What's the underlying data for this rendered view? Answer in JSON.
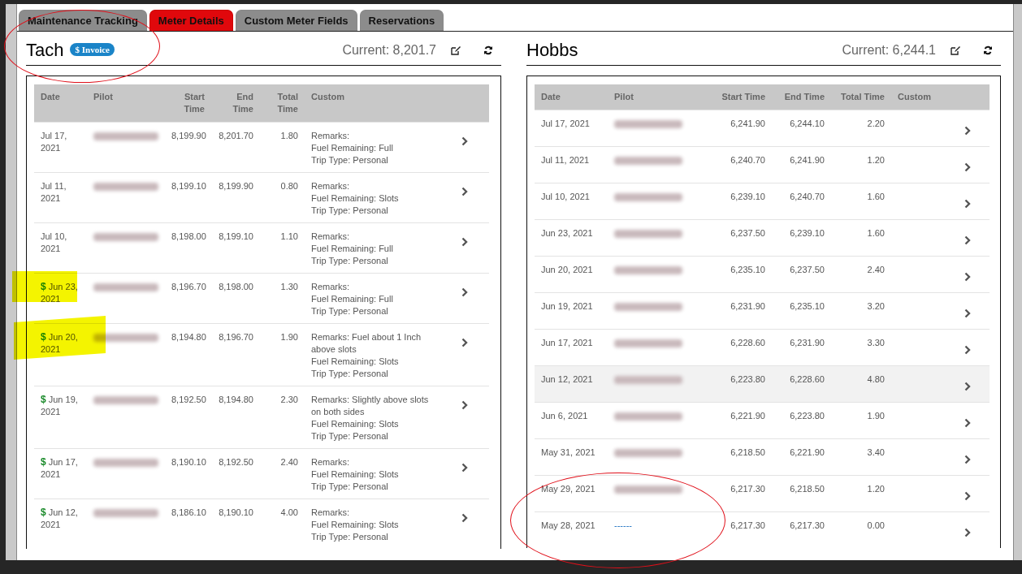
{
  "tabs": [
    {
      "label": "Maintenance Tracking",
      "selected": false
    },
    {
      "label": "Meter Details",
      "selected": true
    },
    {
      "label": "Custom Meter Fields",
      "selected": false
    },
    {
      "label": "Reservations",
      "selected": false
    }
  ],
  "tach": {
    "title": "Tach",
    "badge": "$ Invoice",
    "current": "Current: 8,201.7",
    "columns": [
      "Date",
      "Pilot",
      "Start Time",
      "End Time",
      "Total Time",
      "Custom"
    ],
    "rows": [
      {
        "invoice_mark": "",
        "date": "Jul 17, 2021",
        "pilot_redacted": true,
        "start": "8,199.90",
        "end": "8,201.70",
        "total": "1.80",
        "custom": [
          "Remarks:",
          "Fuel Remaining: Full",
          "Trip Type: Personal"
        ]
      },
      {
        "invoice_mark": "",
        "date": "Jul 11, 2021",
        "pilot_redacted": true,
        "start": "8,199.10",
        "end": "8,199.90",
        "total": "0.80",
        "custom": [
          "Remarks:",
          "Fuel Remaining: Slots",
          "Trip Type: Personal"
        ]
      },
      {
        "invoice_mark": "",
        "date": "Jul 10, 2021",
        "pilot_redacted": true,
        "start": "8,198.00",
        "end": "8,199.10",
        "total": "1.10",
        "custom": [
          "Remarks:",
          "Fuel Remaining: Full",
          "Trip Type: Personal"
        ]
      },
      {
        "invoice_mark": "$",
        "date": "Jun 23, 2021",
        "pilot_redacted": true,
        "start": "8,196.70",
        "end": "8,198.00",
        "total": "1.30",
        "custom": [
          "Remarks:",
          "Fuel Remaining: Full",
          "Trip Type: Personal"
        ]
      },
      {
        "invoice_mark": "$",
        "date": "Jun 20, 2021",
        "pilot_redacted": true,
        "start": "8,194.80",
        "end": "8,196.70",
        "total": "1.90",
        "custom": [
          "Remarks: Fuel about 1 Inch above slots",
          "Fuel Remaining: Slots",
          "Trip Type: Personal"
        ]
      },
      {
        "invoice_mark": "$",
        "date": "Jun 19, 2021",
        "pilot_redacted": true,
        "start": "8,192.50",
        "end": "8,194.80",
        "total": "2.30",
        "custom": [
          "Remarks: Slightly above slots on both sides",
          "Fuel Remaining: Slots",
          "Trip Type: Personal"
        ]
      },
      {
        "invoice_mark": "$",
        "date": "Jun 17, 2021",
        "pilot_redacted": true,
        "start": "8,190.10",
        "end": "8,192.50",
        "total": "2.40",
        "custom": [
          "Remarks:",
          "Fuel Remaining: Slots",
          "Trip Type: Personal"
        ]
      },
      {
        "invoice_mark": "$",
        "date": "Jun 12, 2021",
        "pilot_redacted": true,
        "start": "8,186.10",
        "end": "8,190.10",
        "total": "4.00",
        "custom": [
          "Remarks:",
          "Fuel Remaining: Slots",
          "Trip Type: Personal"
        ]
      }
    ]
  },
  "hobbs": {
    "title": "Hobbs",
    "current": "Current: 6,244.1",
    "columns": [
      "Date",
      "Pilot",
      "Start Time",
      "End Time",
      "Total Time",
      "Custom"
    ],
    "rows": [
      {
        "date": "Jul 17, 2021",
        "pilot_redacted": true,
        "start": "6,241.90",
        "end": "6,244.10",
        "total": "2.20",
        "highlighted": false
      },
      {
        "date": "Jul 11, 2021",
        "pilot_redacted": true,
        "start": "6,240.70",
        "end": "6,241.90",
        "total": "1.20",
        "highlighted": false
      },
      {
        "date": "Jul 10, 2021",
        "pilot_redacted": true,
        "start": "6,239.10",
        "end": "6,240.70",
        "total": "1.60",
        "highlighted": false
      },
      {
        "date": "Jun 23, 2021",
        "pilot_redacted": true,
        "start": "6,237.50",
        "end": "6,239.10",
        "total": "1.60",
        "highlighted": false
      },
      {
        "date": "Jun 20, 2021",
        "pilot_redacted": true,
        "start": "6,235.10",
        "end": "6,237.50",
        "total": "2.40",
        "highlighted": false
      },
      {
        "date": "Jun 19, 2021",
        "pilot_redacted": true,
        "start": "6,231.90",
        "end": "6,235.10",
        "total": "3.20",
        "highlighted": false
      },
      {
        "date": "Jun 17, 2021",
        "pilot_redacted": true,
        "start": "6,228.60",
        "end": "6,231.90",
        "total": "3.30",
        "highlighted": false
      },
      {
        "date": "Jun 12, 2021",
        "pilot_redacted": true,
        "start": "6,223.80",
        "end": "6,228.60",
        "total": "4.80",
        "highlighted": true
      },
      {
        "date": "Jun 6, 2021",
        "pilot_redacted": true,
        "start": "6,221.90",
        "end": "6,223.80",
        "total": "1.90",
        "highlighted": false
      },
      {
        "date": "May 31, 2021",
        "pilot_redacted": true,
        "start": "6,218.50",
        "end": "6,221.90",
        "total": "3.40",
        "highlighted": false
      },
      {
        "date": "May 29, 2021",
        "pilot_redacted": true,
        "start": "6,217.30",
        "end": "6,218.50",
        "total": "1.20",
        "highlighted": false
      },
      {
        "date": "May 28, 2021",
        "pilot_redacted": false,
        "pilot": "------",
        "start": "6,217.30",
        "end": "6,217.30",
        "total": "0.00",
        "highlighted": false
      }
    ]
  },
  "annotations": [
    {
      "kind": "ellipse"
    },
    {
      "kind": "highlight"
    },
    {
      "kind": "highlight"
    },
    {
      "kind": "ellipse"
    }
  ]
}
